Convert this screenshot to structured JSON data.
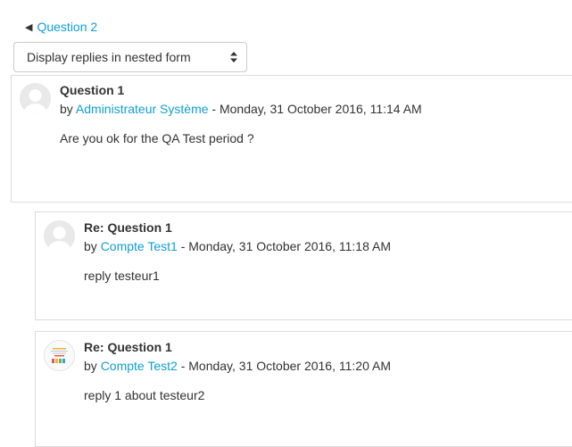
{
  "nav": {
    "prev_label": "Question 2"
  },
  "display_mode": {
    "selected": "Display replies in nested form"
  },
  "posts": [
    {
      "subject": "Question 1",
      "by": "by ",
      "author": "Administrateur Système",
      "date": " - Monday, 31 October 2016, 11:14 AM",
      "message": "Are you ok for the QA Test period ?",
      "avatar": "default-user-icon"
    },
    {
      "subject": "Re: Question 1",
      "by": "by ",
      "author": "Compte Test1",
      "date": " - Monday, 31 October 2016, 11:18 AM",
      "message": "reply testeur1",
      "avatar": "default-user-icon"
    },
    {
      "subject": "Re: Question 1",
      "by": "by ",
      "author": "Compte Test2",
      "date": " - Monday, 31 October 2016, 11:20 AM",
      "message": "reply 1 about testeur2",
      "avatar": "custom-logo-avatar"
    }
  ],
  "colors": {
    "link": "#0f9fd6",
    "text": "#333333",
    "border": "#dddddd"
  }
}
